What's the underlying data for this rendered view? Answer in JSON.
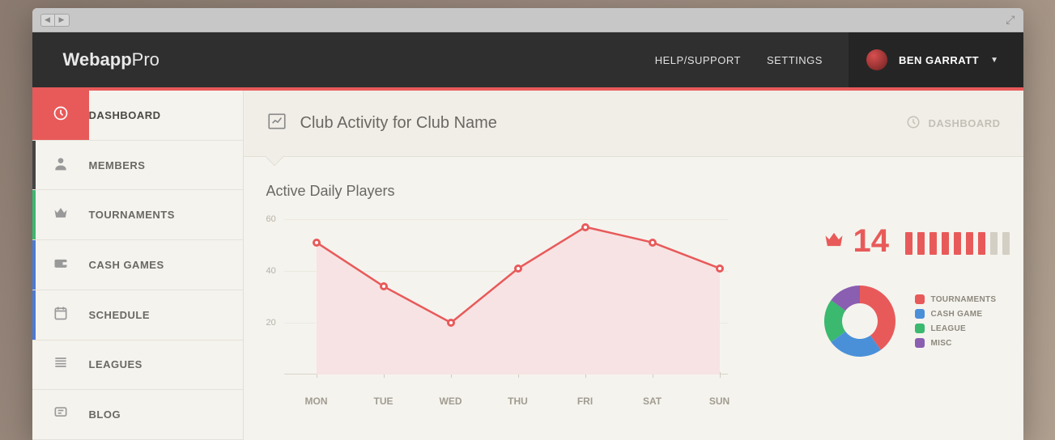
{
  "app": {
    "name_a": "Webapp",
    "name_b": "Pro"
  },
  "header": {
    "help": "HELP/SUPPORT",
    "settings": "SETTINGS",
    "user": "BEN GARRATT"
  },
  "sidebar": {
    "items": [
      {
        "label": "DASHBOARD"
      },
      {
        "label": "MEMBERS"
      },
      {
        "label": "TOURNAMENTS"
      },
      {
        "label": "CASH GAMES"
      },
      {
        "label": "SCHEDULE"
      },
      {
        "label": "LEAGUES"
      },
      {
        "label": "BLOG"
      }
    ]
  },
  "page": {
    "title": "Club Activity for Club Name",
    "breadcrumb": "DASHBOARD"
  },
  "chart_data": {
    "type": "line",
    "title": "Active Daily Players",
    "categories": [
      "MON",
      "TUE",
      "WED",
      "THU",
      "FRI",
      "SAT",
      "SUN"
    ],
    "values": [
      51,
      34,
      20,
      41,
      57,
      51,
      41
    ],
    "xlabel": "",
    "ylabel": "",
    "ylim": [
      0,
      60
    ],
    "y_ticks": [
      20,
      40,
      60
    ]
  },
  "stats": {
    "big_number": "14",
    "sparkbars": [
      1,
      1,
      1,
      1,
      1,
      1,
      1,
      0,
      0
    ]
  },
  "donut": {
    "series": [
      {
        "name": "TOURNAMENTS",
        "value": 40,
        "color": "#e85a5a"
      },
      {
        "name": "CASH GAME",
        "value": 25,
        "color": "#4a90d9"
      },
      {
        "name": "LEAGUE",
        "value": 20,
        "color": "#3ab96f"
      },
      {
        "name": "MISC",
        "value": 15,
        "color": "#8a5eb0"
      }
    ]
  }
}
